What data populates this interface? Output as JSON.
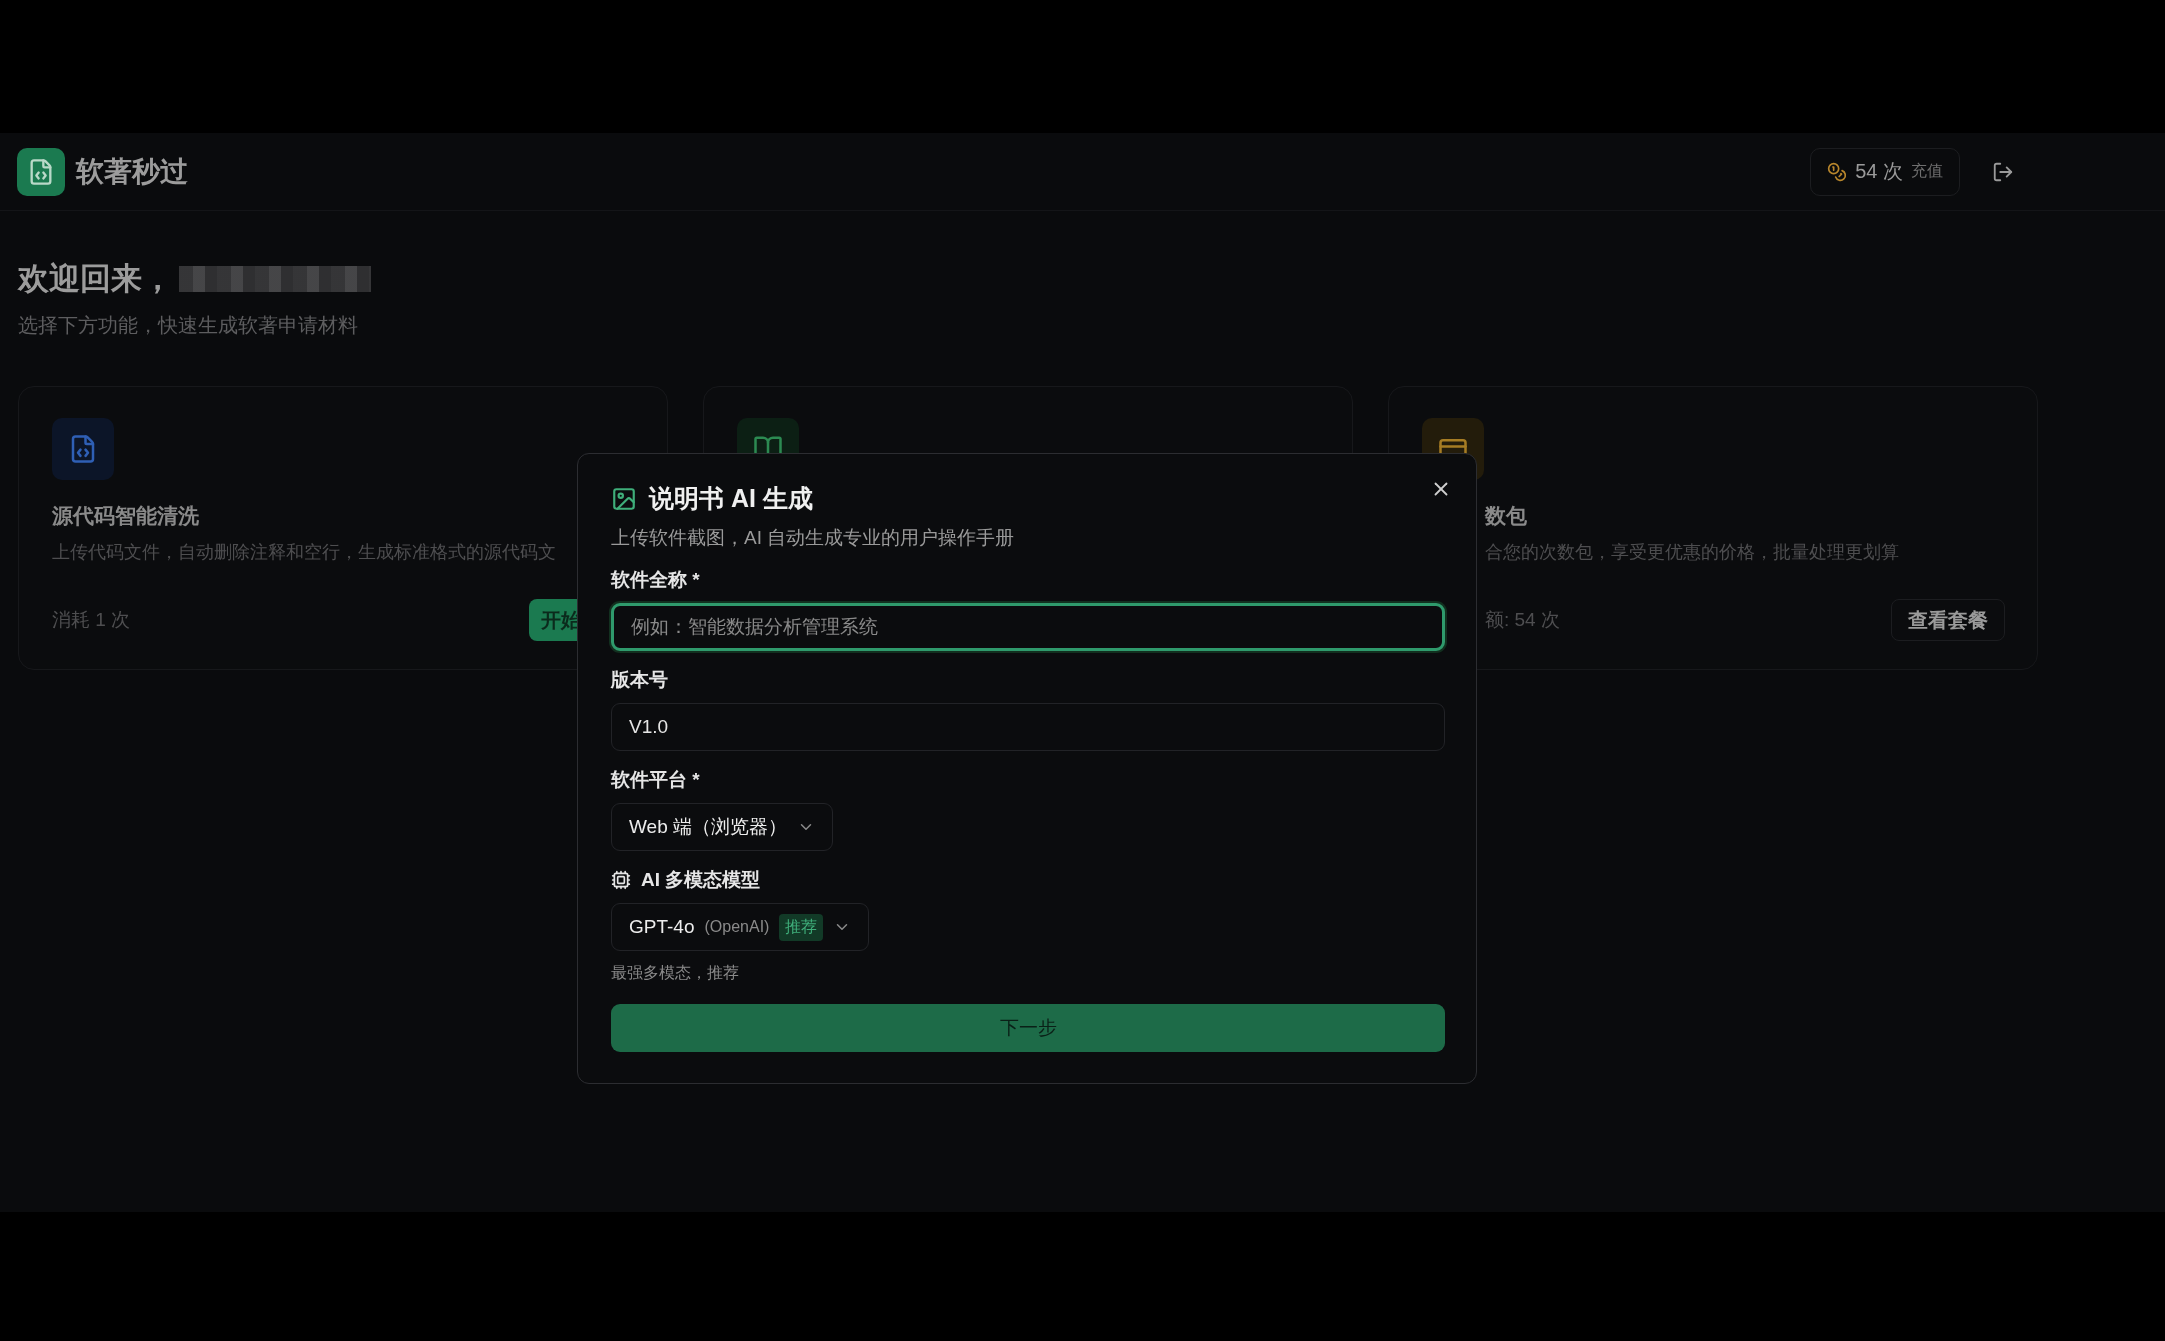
{
  "header": {
    "app_name": "软著秒过",
    "credits": "54 次",
    "recharge": "充值"
  },
  "welcome": {
    "title": "欢迎回来，",
    "subtitle": "选择下方功能，快速生成软著申请材料"
  },
  "cards": [
    {
      "kind": "code",
      "title": "源代码智能清洗",
      "description": "上传代码文件，自动删除注释和空行，生成标准格式的源代码文",
      "cost": "消耗 1 次",
      "button": "开始"
    },
    {
      "kind": "manual"
    },
    {
      "kind": "package",
      "title": "数包",
      "description": "合您的次数包，享受更优惠的价格，批量处理更划算",
      "cost": "额: 54 次",
      "button": "查看套餐"
    }
  ],
  "dialog": {
    "title": "说明书 AI 生成",
    "subtitle": "上传软件截图，AI 自动生成专业的用户操作手册",
    "fields": [
      {
        "kind": "text",
        "label": "软件全称 *",
        "placeholder": "例如：智能数据分析管理系统",
        "focused": true
      },
      {
        "kind": "text",
        "label": "版本号",
        "value": "V1.0",
        "focused": false
      },
      {
        "kind": "select",
        "label": "软件平台 *",
        "value": "Web 端（浏览器）"
      },
      {
        "kind": "model",
        "label": "AI 多模态模型",
        "value": "GPT-4o",
        "vendor": "(OpenAI)",
        "badge": "推荐",
        "hint": "最强多模态，推荐"
      }
    ],
    "submit": "下一步"
  }
}
